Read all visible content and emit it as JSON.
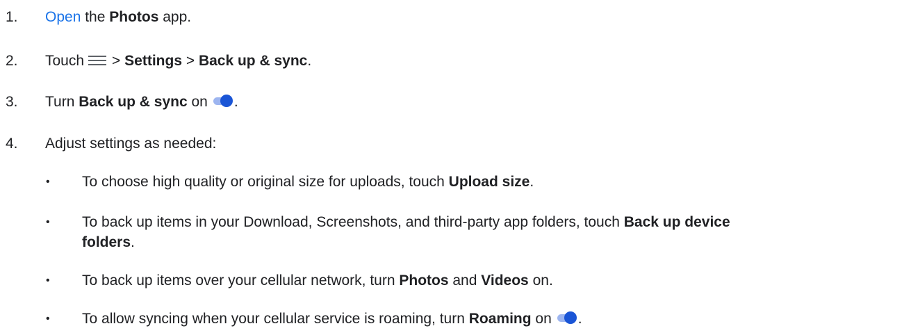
{
  "steps": [
    {
      "number": "1.",
      "link": "Open",
      "t1": " the ",
      "b1": "Photos",
      "t2": " app."
    },
    {
      "number": "2.",
      "t1": "Touch",
      "icon": "menu-icon",
      "t2": "> ",
      "b1": "Settings",
      "t3": " > ",
      "b2": "Back up & sync",
      "t4": "."
    },
    {
      "number": "3.",
      "t1": "Turn ",
      "b1": "Back up & sync",
      "t2": " on",
      "icon": "toggle-on-icon",
      "t3": "."
    },
    {
      "number": "4.",
      "t1": "Adjust settings as needed:"
    }
  ],
  "bullets": [
    {
      "marker": "•",
      "t1": "To choose high quality or original size for uploads, touch ",
      "b1": "Upload size",
      "t2": "."
    },
    {
      "marker": "•",
      "line1_t1": "To back up items in your Download, Screenshots, and third-party app folders, touch ",
      "line1_b1": "Back up device",
      "line2_b1": "folders",
      "line2_t1": "."
    },
    {
      "marker": "•",
      "t1": "To back up items over your cellular network, turn ",
      "b1": "Photos",
      "t2": " and ",
      "b2": "Videos",
      "t3": " on."
    },
    {
      "marker": "•",
      "t1": "To allow syncing when your cellular service is roaming, turn ",
      "b1": "Roaming",
      "t2": " on",
      "icon": "toggle-on-icon",
      "t3": "."
    }
  ],
  "colors": {
    "text": "#202124",
    "link": "#1a73e8",
    "toggle_knob": "#1a55d6",
    "toggle_track": "#9db5f0",
    "menu_icon": "#5f6368"
  }
}
